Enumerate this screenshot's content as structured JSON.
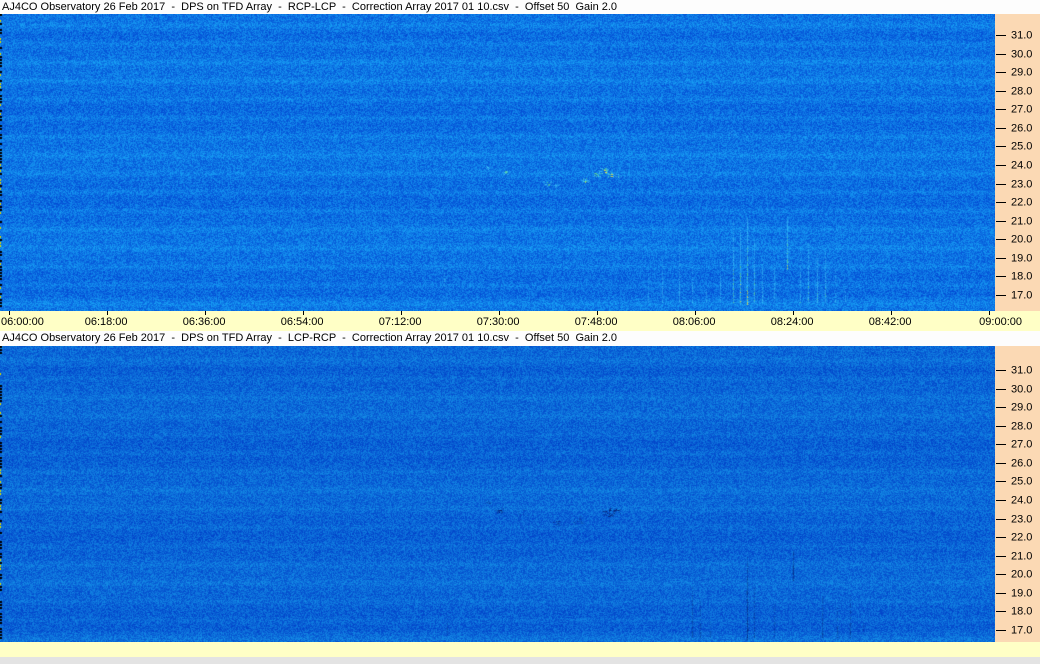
{
  "colors": {
    "scale_bg": "#fbd9b4",
    "time_bg": "#ffffc6",
    "title_bg": "#fdfdfd",
    "footer_bg": "#e3e3e3",
    "tick_color": "#000000",
    "spectrogram_base_blue": "#0c70e2",
    "bright_burst_yellow": "#ebe146",
    "bright_burst_red": "#f06428",
    "dark_burst_navy": "#021060"
  },
  "chart_data": [
    {
      "type": "heatmap",
      "title": "AJ4CO Observatory 26 Feb 2017  -  DPS on TFD Array  -  RCP-LCP  -  Correction Array 2017 01 10.csv  -  Offset 50  Gain 2.0",
      "x_axis": {
        "start": "06:00:00",
        "end": "09:00:00",
        "tick_interval": "00:18:00",
        "show_labels": true,
        "ticks": [
          "06:00:00",
          "06:18:00",
          "06:36:00",
          "06:54:00",
          "07:12:00",
          "07:30:00",
          "07:48:00",
          "08:06:00",
          "08:24:00",
          "08:42:00",
          "09:00:00"
        ]
      },
      "y_axis": {
        "top_value": 31.0,
        "bottom_value": 17.0,
        "step": 1.0,
        "ticks": [
          "31.0",
          "30.0",
          "29.0",
          "28.0",
          "27.0",
          "26.0",
          "25.0",
          "24.0",
          "23.0",
          "22.0",
          "21.0",
          "20.0",
          "19.0",
          "18.0",
          "17.0"
        ]
      },
      "palette": {
        "base": [
          12,
          112,
          226
        ],
        "noise": 38,
        "band_amp": 16,
        "feature_kind": "bright"
      },
      "features": {
        "blobs": [
          {
            "t": "07:27:50",
            "f": 23.9,
            "i": 0.45,
            "s": 3
          },
          {
            "t": "07:31:05",
            "f": 23.6,
            "i": 0.7,
            "s": 3
          },
          {
            "t": "07:38:50",
            "f": 23.0,
            "i": 0.75,
            "s": 4
          },
          {
            "t": "07:40:35",
            "f": 22.9,
            "i": 0.5,
            "s": 3
          },
          {
            "t": "07:45:45",
            "f": 23.2,
            "i": 0.8,
            "s": 4
          },
          {
            "t": "07:47:55",
            "f": 23.5,
            "i": 0.9,
            "s": 4
          },
          {
            "t": "07:49:15",
            "f": 23.7,
            "i": 1.0,
            "s": 5
          },
          {
            "t": "07:50:30",
            "f": 23.5,
            "i": 0.95,
            "s": 4
          },
          {
            "t": "07:51:50",
            "f": 23.4,
            "i": 0.6,
            "s": 3
          },
          {
            "t": "08:13:00",
            "f": 25.7,
            "i": 0.35,
            "s": 6
          }
        ],
        "streaks": [
          {
            "t": "07:19:50",
            "f0": 19.0,
            "f1": 17.5,
            "i": 0.35
          },
          {
            "t": "07:57:25",
            "f0": 18.5,
            "f1": 16.6,
            "i": 0.3
          },
          {
            "t": "08:00:00",
            "f0": 19.5,
            "f1": 16.6,
            "i": 0.4
          },
          {
            "t": "08:03:00",
            "f0": 20.0,
            "f1": 16.6,
            "i": 0.5
          },
          {
            "t": "08:05:30",
            "f0": 19.0,
            "f1": 16.6,
            "i": 0.45
          },
          {
            "t": "08:08:00",
            "f0": 18.0,
            "f1": 16.6,
            "i": 0.35
          },
          {
            "t": "08:10:30",
            "f0": 19.8,
            "f1": 16.6,
            "i": 0.4
          },
          {
            "t": "08:13:00",
            "f0": 21.0,
            "f1": 16.6,
            "i": 0.7
          },
          {
            "t": "08:14:20",
            "f0": 20.5,
            "f1": 16.5,
            "i": 0.9
          },
          {
            "t": "08:15:30",
            "f0": 21.2,
            "f1": 16.5,
            "i": 0.85
          },
          {
            "t": "08:16:50",
            "f0": 20.0,
            "f1": 16.6,
            "i": 0.7
          },
          {
            "t": "08:18:20",
            "f0": 19.0,
            "f1": 16.6,
            "i": 0.5
          },
          {
            "t": "08:20:30",
            "f0": 19.3,
            "f1": 16.6,
            "i": 0.45
          },
          {
            "t": "08:22:55",
            "f0": 21.2,
            "f1": 18.4,
            "i": 0.8
          },
          {
            "t": "08:25:20",
            "f0": 19.5,
            "f1": 16.6,
            "i": 0.5
          },
          {
            "t": "08:26:45",
            "f0": 19.8,
            "f1": 16.6,
            "i": 0.65
          },
          {
            "t": "08:28:25",
            "f0": 19.2,
            "f1": 16.6,
            "i": 0.6
          },
          {
            "t": "08:29:50",
            "f0": 19.6,
            "f1": 16.6,
            "i": 0.55
          },
          {
            "t": "08:31:40",
            "f0": 18.5,
            "f1": 16.6,
            "i": 0.4
          },
          {
            "t": "08:33:30",
            "f0": 18.2,
            "f1": 16.6,
            "i": 0.35
          }
        ]
      }
    },
    {
      "type": "heatmap",
      "title": "AJ4CO Observatory 26 Feb 2017  -  DPS on TFD Array  -  LCP-RCP  -  Correction Array 2017 01 10.csv  -  Offset 50  Gain 2.0",
      "x_axis": {
        "start": "06:00:00",
        "end": "09:00:00",
        "tick_interval": "00:18:00",
        "show_labels": false,
        "ticks": []
      },
      "y_axis": {
        "top_value": 31.0,
        "bottom_value": 17.0,
        "step": 1.0,
        "ticks": [
          "31.0",
          "30.0",
          "29.0",
          "28.0",
          "27.0",
          "26.0",
          "25.0",
          "24.0",
          "23.0",
          "22.0",
          "21.0",
          "20.0",
          "19.0",
          "18.0",
          "17.0"
        ]
      },
      "palette": {
        "base": [
          10,
          100,
          214
        ],
        "noise": 34,
        "band_amp": 11,
        "feature_kind": "dark"
      },
      "features": {
        "blobs": [
          {
            "t": "07:27:50",
            "f": 23.9,
            "i": 0.4,
            "s": 3
          },
          {
            "t": "07:30:00",
            "f": 23.45,
            "i": 0.7,
            "s": 4
          },
          {
            "t": "07:34:00",
            "f": 23.2,
            "i": 0.25,
            "s": 10
          },
          {
            "t": "07:40:30",
            "f": 22.75,
            "i": 0.5,
            "s": 4
          },
          {
            "t": "07:44:30",
            "f": 22.9,
            "i": 0.35,
            "s": 7
          },
          {
            "t": "07:50:00",
            "f": 23.35,
            "i": 1.0,
            "s": 6
          },
          {
            "t": "07:51:30",
            "f": 23.4,
            "i": 0.8,
            "s": 4
          }
        ],
        "streaks": [
          {
            "t": "07:20:30",
            "f0": 18.4,
            "f1": 16.8,
            "i": 0.3
          },
          {
            "t": "08:05:30",
            "f0": 19.3,
            "f1": 16.6,
            "i": 0.5
          },
          {
            "t": "08:07:00",
            "f0": 18.6,
            "f1": 16.6,
            "i": 0.45
          },
          {
            "t": "08:08:50",
            "f0": 17.9,
            "f1": 16.6,
            "i": 0.3
          },
          {
            "t": "08:15:30",
            "f0": 21.0,
            "f1": 16.5,
            "i": 0.8
          },
          {
            "t": "08:16:50",
            "f0": 19.5,
            "f1": 16.6,
            "i": 0.5
          },
          {
            "t": "08:20:30",
            "f0": 18.8,
            "f1": 16.6,
            "i": 0.35
          },
          {
            "t": "08:24:00",
            "f0": 21.3,
            "f1": 19.7,
            "i": 0.85
          },
          {
            "t": "08:29:20",
            "f0": 18.9,
            "f1": 16.6,
            "i": 0.5
          },
          {
            "t": "08:32:00",
            "f0": 18.4,
            "f1": 16.6,
            "i": 0.4
          },
          {
            "t": "08:34:30",
            "f0": 19.0,
            "f1": 16.6,
            "i": 0.55
          },
          {
            "t": "08:36:50",
            "f0": 17.8,
            "f1": 16.6,
            "i": 0.3
          }
        ]
      }
    }
  ]
}
